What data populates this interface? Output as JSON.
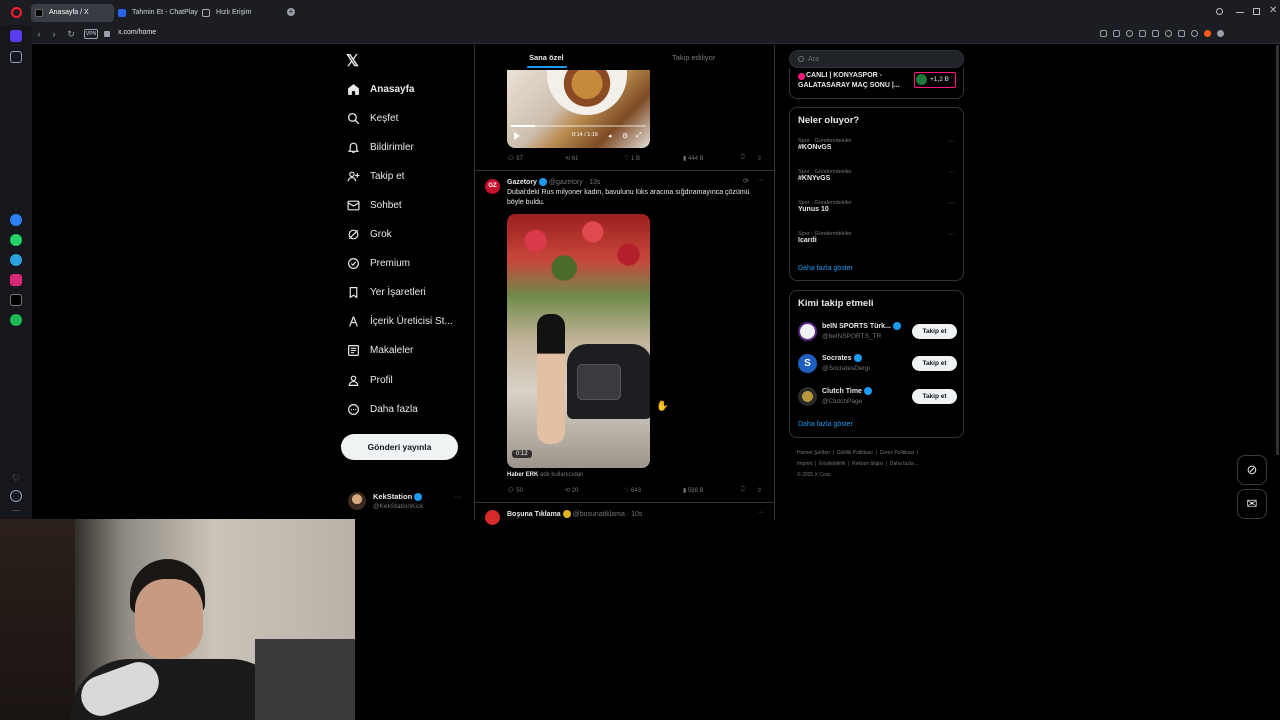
{
  "browser": {
    "tabs": [
      {
        "label": "Anasayfa / X"
      },
      {
        "label": "Tahmin Et - ChatPlay"
      },
      {
        "label": "Hızlı Erişim"
      }
    ],
    "url": "x.com/home",
    "vpn_label": "VPN"
  },
  "nav": {
    "items": [
      {
        "label": "Anasayfa",
        "icon": "home-icon"
      },
      {
        "label": "Keşfet",
        "icon": "search-icon"
      },
      {
        "label": "Bildirimler",
        "icon": "bell-icon"
      },
      {
        "label": "Takip et",
        "icon": "follow-icon"
      },
      {
        "label": "Sohbet",
        "icon": "mail-icon"
      },
      {
        "label": "Grok",
        "icon": "grok-icon"
      },
      {
        "label": "Premium",
        "icon": "premium-icon"
      },
      {
        "label": "Yer İşaretleri",
        "icon": "bookmark-icon"
      },
      {
        "label": "İçerik Üreticisi St...",
        "icon": "creator-icon"
      },
      {
        "label": "Makaleler",
        "icon": "article-icon"
      },
      {
        "label": "Profil",
        "icon": "profile-icon"
      },
      {
        "label": "Daha fazla",
        "icon": "more-circle-icon"
      }
    ],
    "post_button": "Gönderi yayınla",
    "account": {
      "name": "KekStation",
      "handle": "@KekStationKick"
    }
  },
  "feed": {
    "tabs": [
      "Sana özel",
      "Takip ediliyor"
    ],
    "post1": {
      "video_time": "0:14 / 1:16",
      "stats": {
        "replies": "57",
        "reposts": "61",
        "likes": "1 B",
        "views": "444 B"
      }
    },
    "post2": {
      "author": "Gazetory",
      "handle": "@gazetory · 13s",
      "avatar_text": "GZ",
      "text": "Dubai'deki Rus milyoner kadın, bavulunu lüks aracına sığdıramayınca çözümü böyle buldu.",
      "video_duration": "0:12",
      "source_name": "Haber ERK",
      "source_suffix": "adlı kullanıcıdan",
      "stats": {
        "replies": "50",
        "reposts": "20",
        "likes": "643",
        "views": "598 B"
      }
    },
    "post3": {
      "author": "Boşuna Tıklama",
      "handle": "@bosunatiklama · 10s"
    }
  },
  "right": {
    "search_placeholder": "Ara",
    "live": {
      "text_line1": "CANLI | KONYASPOR -",
      "text_line2": "GALATASARAY MAÇ SONU |...",
      "count": "+1,2 B"
    },
    "trends_title": "Neler oluyor?",
    "trends": [
      {
        "category": "Spor · Gündemdekiler",
        "name": "#KONvGS"
      },
      {
        "category": "Spor · Gündemdekiler",
        "name": "#KNYvGS"
      },
      {
        "category": "Spor · Gündemdekiler",
        "name": "Yunus 10"
      },
      {
        "category": "Spor · Gündemdekiler",
        "name": "Icardi"
      }
    ],
    "show_more": "Daha fazla göster",
    "who_title": "Kimi takip etmeli",
    "who": [
      {
        "name": "beIN SPORTS Türk...",
        "handle": "@beINSPORTS_TR",
        "button": "Takip et"
      },
      {
        "name": "Socrates",
        "handle": "@SocratesDergi",
        "button": "Takip et"
      },
      {
        "name": "Clutch Time",
        "handle": "@ClutchPage",
        "button": "Takip et"
      }
    ],
    "who_more": "Daha fazla göster",
    "footer": {
      "line1": [
        "Hizmet Şartları",
        "Gizlilik Politikası",
        "Çerez Politikası"
      ],
      "line2": [
        "Imprint",
        "Erişilebilirlik",
        "Reklam bilgisi",
        "Daha fazla ..."
      ],
      "copyright": "© 2025 X Corp."
    }
  },
  "colors": {
    "accent": "#1d9bf0",
    "live_border": "#f91880"
  }
}
